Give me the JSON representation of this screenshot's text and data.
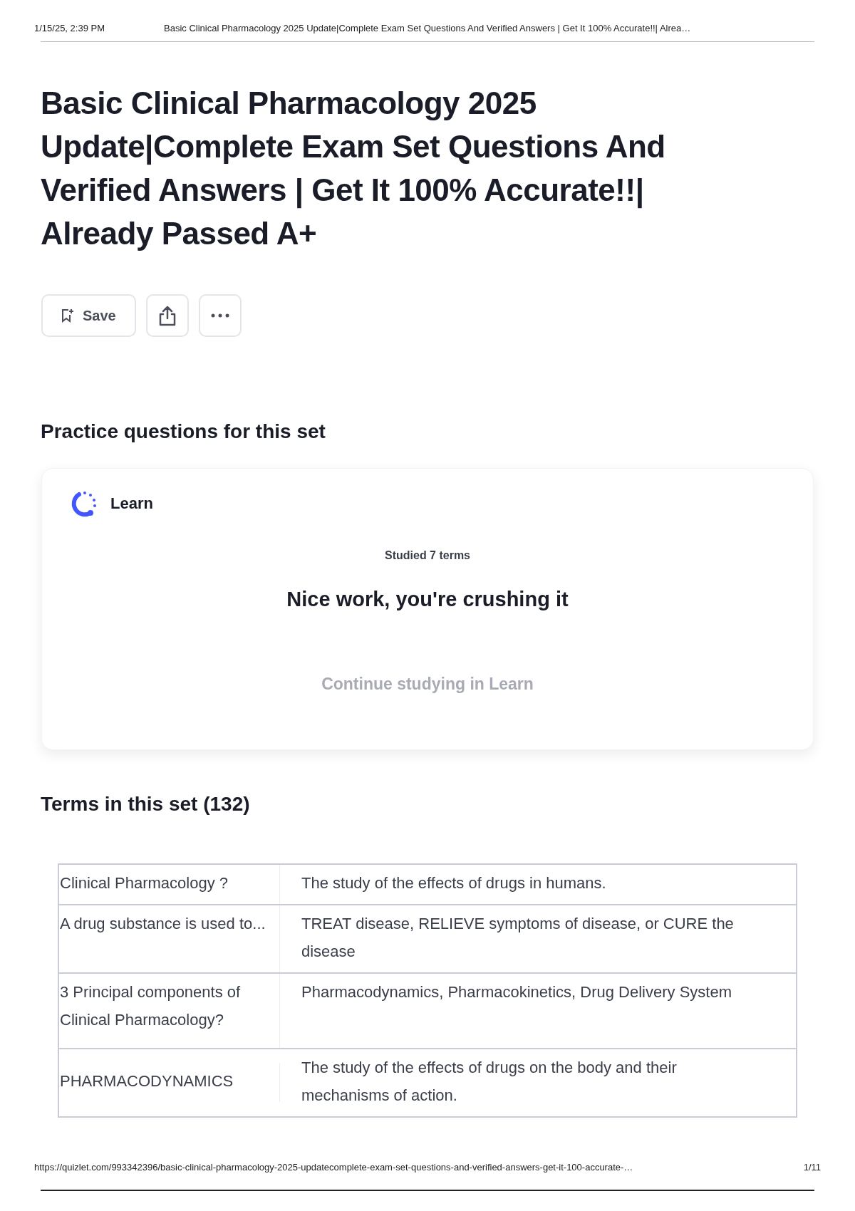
{
  "print_header": {
    "date": "1/15/25, 2:39 PM",
    "title": "Basic Clinical Pharmacology 2025 Update|Complete Exam Set Questions And Verified Answers | Get It 100% Accurate!!| Alrea…"
  },
  "title": "Basic Clinical Pharmacology 2025 Update|Complete Exam Set Questions And Verified Answers | Get It 100% Accurate!!| Already Passed A+",
  "actions": {
    "save": "Save"
  },
  "practice": {
    "heading": "Practice questions for this set",
    "card": {
      "mode": "Learn",
      "studied": "Studied 7 terms",
      "message": "Nice work, you're crushing it",
      "link": "Continue studying in Learn"
    }
  },
  "terms": {
    "heading": "Terms in this set (132)",
    "rows": [
      {
        "term": "Clinical Pharmacology ?",
        "definition": "The study of the effects of drugs in humans."
      },
      {
        "term": "A drug substance is used to...",
        "definition": "TREAT disease, RELIEVE symptoms of disease, or CURE the disease"
      },
      {
        "term": "3 Principal components of Clinical Pharmacology?",
        "definition": "Pharmacodynamics, Pharmacokinetics, Drug Delivery System"
      },
      {
        "term": "PHARMACODYNAMICS",
        "definition": "The study of the effects of drugs on the body and their mechanisms of action."
      }
    ]
  },
  "print_footer": {
    "url": "https://quizlet.com/993342396/basic-clinical-pharmacology-2025-updatecomplete-exam-set-questions-and-verified-answers-get-it-100-accurate-…",
    "page": "1/11"
  }
}
